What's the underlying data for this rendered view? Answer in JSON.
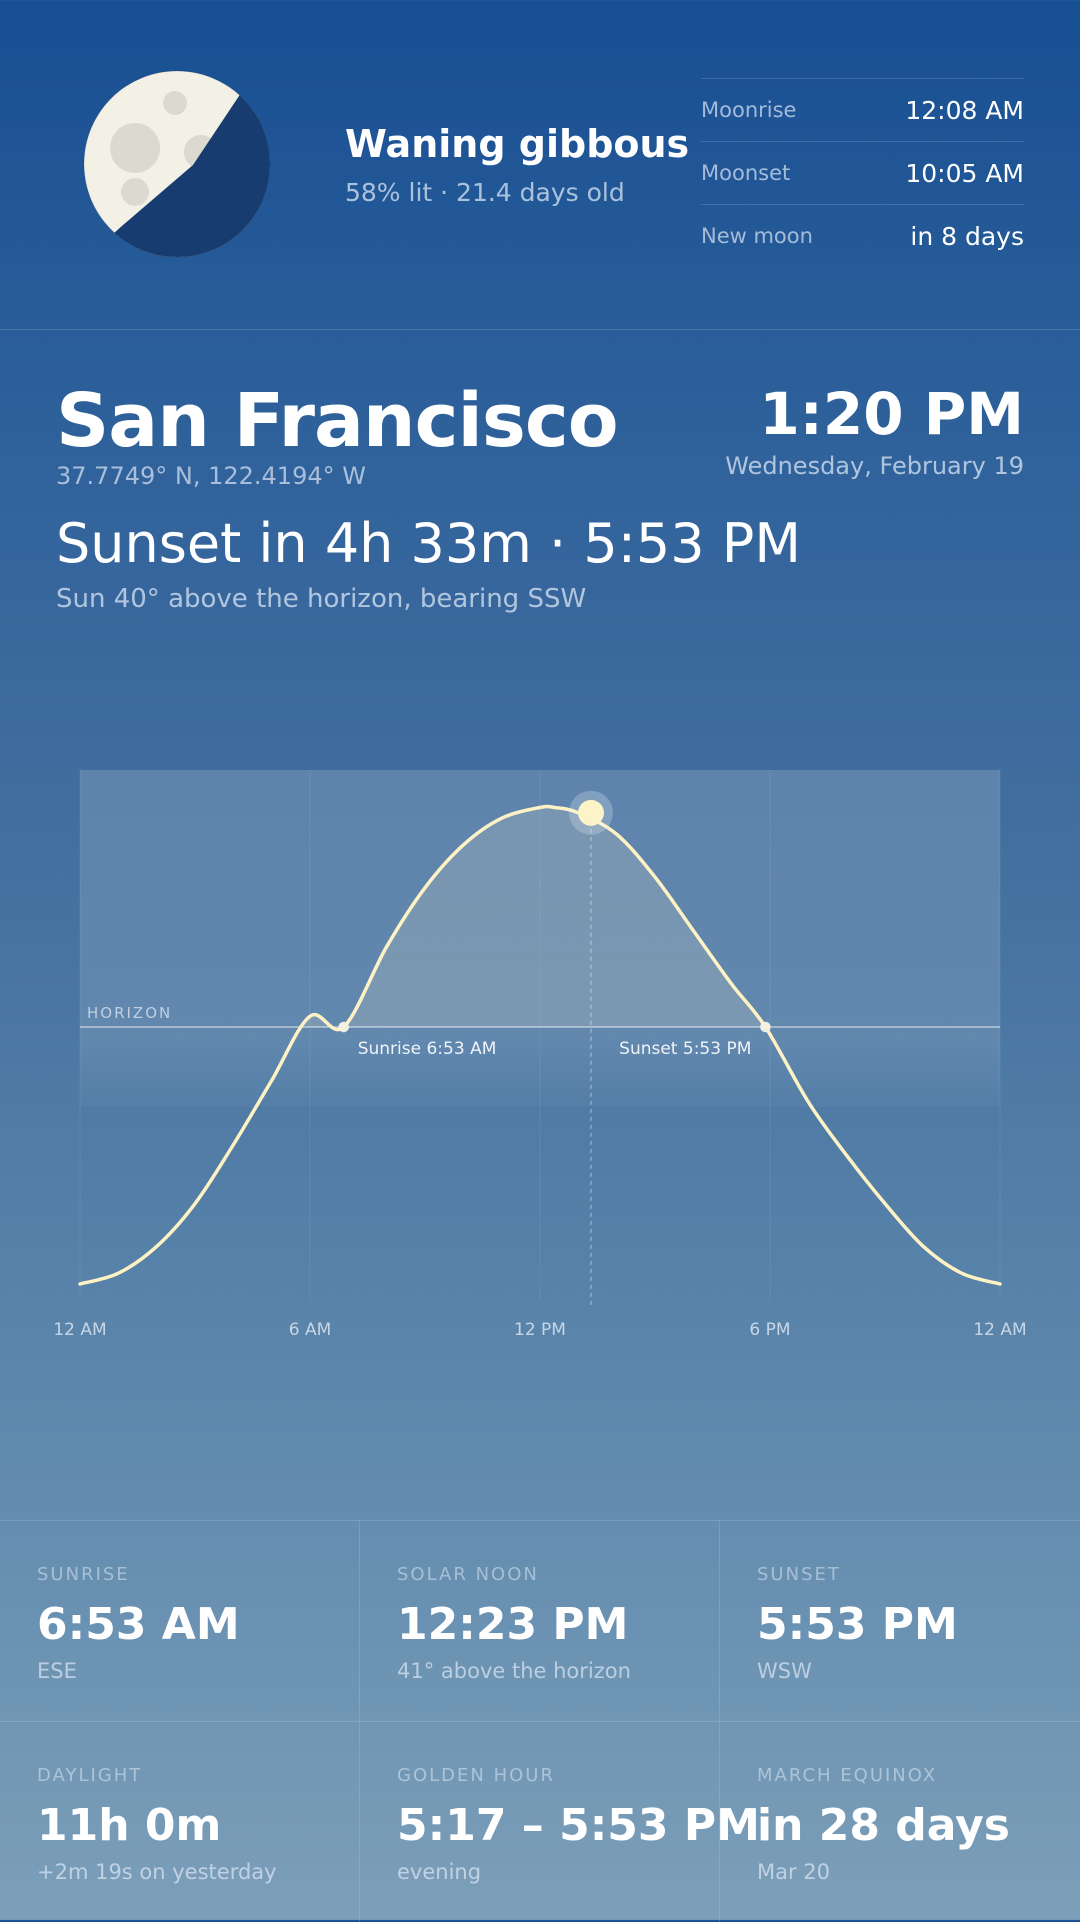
{
  "moon": {
    "phase_name": "Waning gibbous",
    "detail": "58% lit · 21.4 days old",
    "icon": "moon-phase-icon",
    "rows": [
      {
        "label": "Moonrise",
        "value": "12:08 AM"
      },
      {
        "label": "Moonset",
        "value": "10:05 AM"
      },
      {
        "label": "New moon",
        "value": "in 8 days"
      }
    ]
  },
  "location": {
    "city": "San Francisco",
    "coords": "37.7749° N, 122.4194° W"
  },
  "now": {
    "time": "1:20 PM",
    "date": "Wednesday, February 19"
  },
  "headline": "Sunset in 4h 33m · 5:53 PM",
  "subline": "Sun 40° above the horizon, bearing SSW",
  "chart_data": {
    "type": "line",
    "series": [
      {
        "x": [
          0,
          1,
          2,
          3,
          4,
          5,
          6,
          6.88,
          8,
          9,
          10,
          11,
          12,
          12.38,
          13,
          14,
          15,
          16,
          17,
          17.88,
          19,
          20,
          21,
          22,
          23,
          24
        ],
        "values": [
          -48,
          -46,
          -41,
          -33,
          -22,
          -10,
          2,
          0,
          15,
          26,
          34,
          39,
          41,
          41,
          40,
          36,
          28,
          18,
          8,
          0,
          -14,
          -24,
          -33,
          -41,
          -46,
          -48
        ]
      }
    ],
    "current": {
      "x": 13.33,
      "value": 40
    },
    "horizon_label": "HORIZON",
    "horizon_value": 0,
    "markers": [
      {
        "x": 6.88,
        "label": "Sunrise 6:53 AM"
      },
      {
        "x": 17.88,
        "label": "Sunset 5:53 PM"
      }
    ],
    "x_ticks": [
      {
        "x": 0,
        "label": "12 AM"
      },
      {
        "x": 6,
        "label": "6 AM"
      },
      {
        "x": 12,
        "label": "12 PM"
      },
      {
        "x": 18,
        "label": "6 PM"
      },
      {
        "x": 24,
        "label": "12 AM"
      }
    ],
    "xlim": [
      0,
      24
    ],
    "ylim": [
      -51,
      48
    ],
    "grid": true,
    "colors": {
      "curve": "#fdf2c4",
      "sun": "#fdf3c8"
    }
  },
  "stats": [
    {
      "label": "SUNRISE",
      "value": "6:53 AM",
      "sub": "ESE"
    },
    {
      "label": "SOLAR NOON",
      "value": "12:23 PM",
      "sub": "41° above the horizon"
    },
    {
      "label": "SUNSET",
      "value": "5:53 PM",
      "sub": "WSW"
    },
    {
      "label": "DAYLIGHT",
      "value": "11h 0m",
      "sub": "+2m 19s on yesterday"
    },
    {
      "label": "GOLDEN HOUR",
      "value": "5:17 – 5:53 PM",
      "sub": "evening"
    },
    {
      "label": "MARCH EQUINOX",
      "value": "in 28 days",
      "sub": "Mar 20"
    }
  ]
}
